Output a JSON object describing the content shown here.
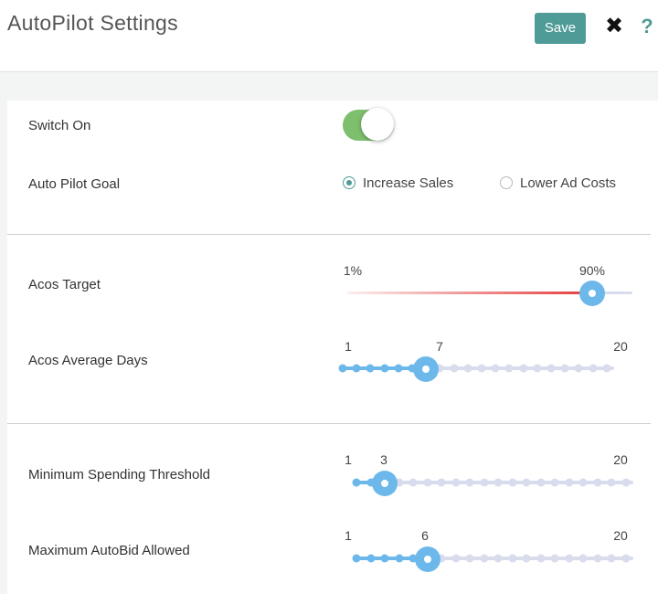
{
  "header": {
    "title": "AutoPilot Settings",
    "save_label": "Save",
    "close_glyph": "✖",
    "help_glyph": "?"
  },
  "switch": {
    "label": "Switch On",
    "on": true
  },
  "goal": {
    "label": "Auto Pilot Goal",
    "options": [
      {
        "label": "Increase Sales",
        "selected": true
      },
      {
        "label": "Lower Ad Costs",
        "selected": false
      }
    ]
  },
  "acos_target": {
    "label": "Acos Target",
    "min_label": "1%",
    "value_label": "90%",
    "min": 1,
    "max": 100,
    "value": 90
  },
  "acos_days": {
    "label": "Acos Average Days",
    "min_label": "1",
    "value_label": "7",
    "max_label": "20",
    "min": 1,
    "max": 20,
    "value": 7
  },
  "min_spend": {
    "label": "Minimum Spending Threshold",
    "min_label": "1",
    "value_label": "3",
    "max_label": "20",
    "min": 1,
    "max": 20,
    "value": 3
  },
  "max_autobid": {
    "label": "Maximum AutoBid Allowed",
    "min_label": "1",
    "value_label": "6",
    "max_label": "20",
    "min": 1,
    "max": 20,
    "value": 6
  },
  "colors": {
    "accent": "#4e9b97",
    "toggle_on": "#7dbf6d",
    "slider_blue": "#6db8ea",
    "slider_light": "#d8dced",
    "acos_gradient_start": "#fbeeee",
    "acos_gradient_end": "#e53a3a"
  },
  "icons": {
    "close": "close-icon",
    "help": "help-icon"
  }
}
